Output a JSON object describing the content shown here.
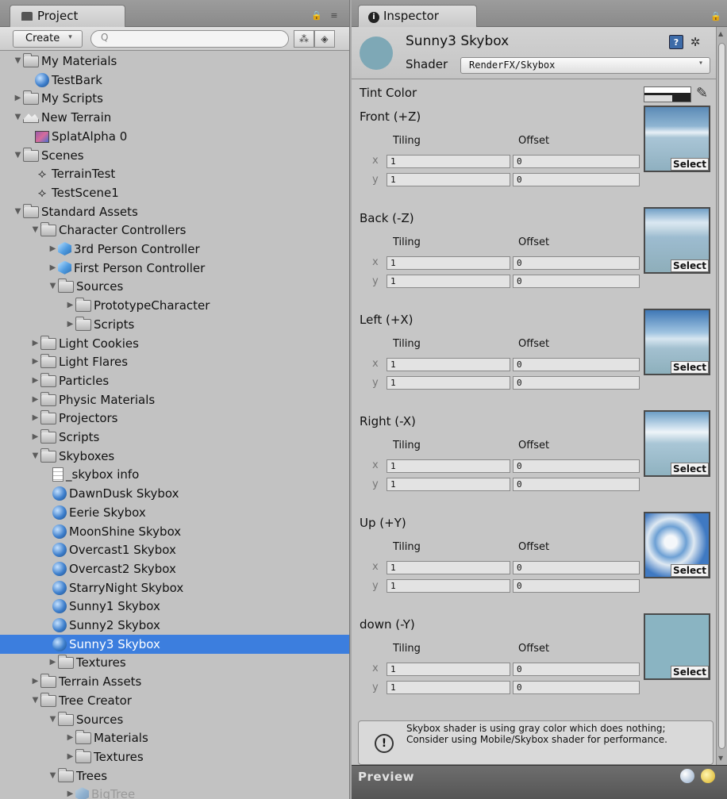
{
  "project": {
    "tab_label": "Project",
    "create_label": "Create",
    "search_placeholder": "Q",
    "tree": [
      {
        "label": "My Materials",
        "depth": 0,
        "icon": "folder",
        "arrow": "open"
      },
      {
        "label": "TestBark",
        "depth": 1,
        "icon": "sphere",
        "arrow": ""
      },
      {
        "label": "My Scripts",
        "depth": 0,
        "icon": "folder",
        "arrow": "closed"
      },
      {
        "label": "New Terrain",
        "depth": 0,
        "icon": "terrain",
        "arrow": "open"
      },
      {
        "label": "SplatAlpha 0",
        "depth": 1,
        "icon": "texture",
        "arrow": ""
      },
      {
        "label": "Scenes",
        "depth": 0,
        "icon": "folder",
        "arrow": "open"
      },
      {
        "label": "TerrainTest",
        "depth": 1,
        "icon": "unity",
        "arrow": ""
      },
      {
        "label": "TestScene1",
        "depth": 1,
        "icon": "unity",
        "arrow": ""
      },
      {
        "label": "Standard Assets",
        "depth": 0,
        "icon": "folder",
        "arrow": "open"
      },
      {
        "label": "Character Controllers",
        "depth": 1,
        "icon": "folder",
        "arrow": "open"
      },
      {
        "label": "3rd Person Controller",
        "depth": 2,
        "icon": "cube",
        "arrow": "closed"
      },
      {
        "label": "First Person Controller",
        "depth": 2,
        "icon": "cube",
        "arrow": "closed"
      },
      {
        "label": "Sources",
        "depth": 2,
        "icon": "folder",
        "arrow": "open"
      },
      {
        "label": "PrototypeCharacter",
        "depth": 3,
        "icon": "folder",
        "arrow": "closed"
      },
      {
        "label": "Scripts",
        "depth": 3,
        "icon": "folder",
        "arrow": "closed"
      },
      {
        "label": "Light Cookies",
        "depth": 1,
        "icon": "folder",
        "arrow": "closed"
      },
      {
        "label": "Light Flares",
        "depth": 1,
        "icon": "folder",
        "arrow": "closed"
      },
      {
        "label": "Particles",
        "depth": 1,
        "icon": "folder",
        "arrow": "closed"
      },
      {
        "label": "Physic Materials",
        "depth": 1,
        "icon": "folder",
        "arrow": "closed"
      },
      {
        "label": "Projectors",
        "depth": 1,
        "icon": "folder",
        "arrow": "closed"
      },
      {
        "label": "Scripts",
        "depth": 1,
        "icon": "folder",
        "arrow": "closed"
      },
      {
        "label": "Skyboxes",
        "depth": 1,
        "icon": "folder",
        "arrow": "open"
      },
      {
        "label": "_skybox info",
        "depth": 2,
        "icon": "doc",
        "arrow": ""
      },
      {
        "label": "DawnDusk Skybox",
        "depth": 2,
        "icon": "sphere",
        "arrow": ""
      },
      {
        "label": "Eerie Skybox",
        "depth": 2,
        "icon": "sphere",
        "arrow": ""
      },
      {
        "label": "MoonShine Skybox",
        "depth": 2,
        "icon": "sphere",
        "arrow": ""
      },
      {
        "label": "Overcast1 Skybox",
        "depth": 2,
        "icon": "sphere",
        "arrow": ""
      },
      {
        "label": "Overcast2 Skybox",
        "depth": 2,
        "icon": "sphere",
        "arrow": ""
      },
      {
        "label": "StarryNight Skybox",
        "depth": 2,
        "icon": "sphere",
        "arrow": ""
      },
      {
        "label": "Sunny1 Skybox",
        "depth": 2,
        "icon": "sphere",
        "arrow": ""
      },
      {
        "label": "Sunny2 Skybox",
        "depth": 2,
        "icon": "sphere",
        "arrow": ""
      },
      {
        "label": "Sunny3 Skybox",
        "depth": 2,
        "icon": "sphere",
        "arrow": "",
        "selected": true
      },
      {
        "label": "Textures",
        "depth": 2,
        "icon": "folder",
        "arrow": "closed"
      },
      {
        "label": "Terrain Assets",
        "depth": 1,
        "icon": "folder",
        "arrow": "closed"
      },
      {
        "label": "Tree Creator",
        "depth": 1,
        "icon": "folder",
        "arrow": "open"
      },
      {
        "label": "Sources",
        "depth": 2,
        "icon": "folder",
        "arrow": "open"
      },
      {
        "label": "Materials",
        "depth": 3,
        "icon": "folder",
        "arrow": "closed"
      },
      {
        "label": "Textures",
        "depth": 3,
        "icon": "folder",
        "arrow": "closed"
      },
      {
        "label": "Trees",
        "depth": 2,
        "icon": "folder",
        "arrow": "open"
      },
      {
        "label": "BigTree",
        "depth": 3,
        "icon": "cube",
        "arrow": "closed",
        "faded": true
      }
    ]
  },
  "inspector": {
    "tab_label": "Inspector",
    "material_name": "Sunny3 Skybox",
    "shader_label": "Shader",
    "shader_value": "RenderFX/Skybox",
    "tint_label": "Tint Color",
    "tiling_label": "Tiling",
    "offset_label": "Offset",
    "x_label": "x",
    "y_label": "y",
    "select_label": "Select",
    "faces": [
      {
        "name": "Front (+Z)",
        "tiling_x": "1",
        "tiling_y": "1",
        "offset_x": "0",
        "offset_y": "0",
        "sky": "sky1"
      },
      {
        "name": "Back (-Z)",
        "tiling_x": "1",
        "tiling_y": "1",
        "offset_x": "0",
        "offset_y": "0",
        "sky": "sky2"
      },
      {
        "name": "Left (+X)",
        "tiling_x": "1",
        "tiling_y": "1",
        "offset_x": "0",
        "offset_y": "0",
        "sky": "sky3"
      },
      {
        "name": "Right (-X)",
        "tiling_x": "1",
        "tiling_y": "1",
        "offset_x": "0",
        "offset_y": "0",
        "sky": "sky4"
      },
      {
        "name": "Up (+Y)",
        "tiling_x": "1",
        "tiling_y": "1",
        "offset_x": "0",
        "offset_y": "0",
        "sky": "sky5"
      },
      {
        "name": "down (-Y)",
        "tiling_x": "1",
        "tiling_y": "1",
        "offset_x": "0",
        "offset_y": "0",
        "sky": "sky6"
      }
    ],
    "warning": "Skybox shader is using gray color which does nothing; Consider using Mobile/Skybox shader for performance.",
    "preview_label": "Preview"
  },
  "colors": {
    "selection": "#3c7ede",
    "material_swatch": "#7ea8b6"
  }
}
